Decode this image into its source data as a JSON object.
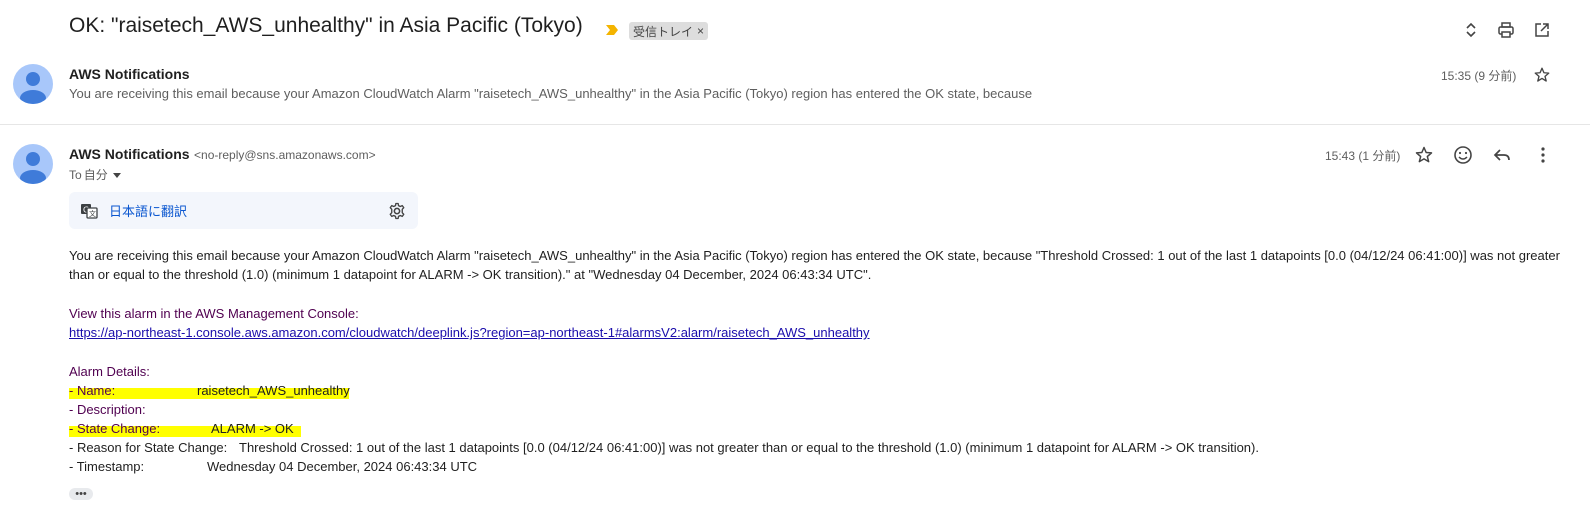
{
  "thread": {
    "subject": "OK: \"raisetech_AWS_unhealthy\" in Asia Pacific (Tokyo)",
    "label": "受信トレイ",
    "label_remove": "×",
    "important_color": "#f4b400"
  },
  "toolbar": {
    "expand_icon": "unfold-icon",
    "print_icon": "print-icon",
    "popout_icon": "open-in-new-icon"
  },
  "message_collapsed": {
    "sender": "AWS Notifications",
    "time": "15:35 (9 分前)",
    "snippet": "You are receiving this email because your Amazon CloudWatch Alarm \"raisetech_AWS_unhealthy\" in the Asia Pacific (Tokyo) region has entered the OK state, because"
  },
  "message": {
    "sender": "AWS Notifications",
    "email": "<no-reply@sns.amazonaws.com>",
    "to_prefix": "To",
    "to": "自分",
    "time": "15:43 (1 分前)",
    "translate": "日本語に翻訳",
    "body_line1": "You are receiving this email because your Amazon CloudWatch Alarm \"raisetech_AWS_unhealthy\" in the Asia Pacific (Tokyo) region has entered the OK state, because \"Threshold Crossed: 1 out of the last 1 datapoints [0.0 (04/12/24 06:41:00)] was not greater",
    "body_line2": "than or equal to the threshold (1.0) (minimum 1 datapoint for ALARM -> OK transition).\" at \"Wednesday 04 December, 2024 06:43:34 UTC\".",
    "console_label": "View this alarm in the AWS Management Console:",
    "console_link": "https://ap-northeast-1.console.aws.amazon.com/cloudwatch/deeplink.js?region=ap-northeast-1#alarmsV2:alarm/raisetech_AWS_unhealthy",
    "details_heading": "Alarm Details:",
    "details": {
      "name_label": "- Name:",
      "name_value": "raisetech_AWS_unhealthy",
      "description_label": "- Description:",
      "state_label": "- State Change:",
      "state_value": "ALARM -> OK",
      "reason_label": "- Reason for State Change:",
      "reason_value": "Threshold Crossed: 1 out of the last 1 datapoints [0.0 (04/12/24 06:41:00)] was not greater than or equal to the threshold (1.0) (minimum 1 datapoint for ALARM -> OK transition).",
      "timestamp_label": "- Timestamp:",
      "timestamp_value": "Wednesday 04 December, 2024 06:43:34 UTC"
    },
    "more": "•••"
  },
  "colors": {
    "highlight": "#ffff00",
    "link": "#1a0dab",
    "details_purple": "#500050",
    "avatar_bg": "#a8c7fa",
    "avatar_fg": "#3f7bd9"
  }
}
